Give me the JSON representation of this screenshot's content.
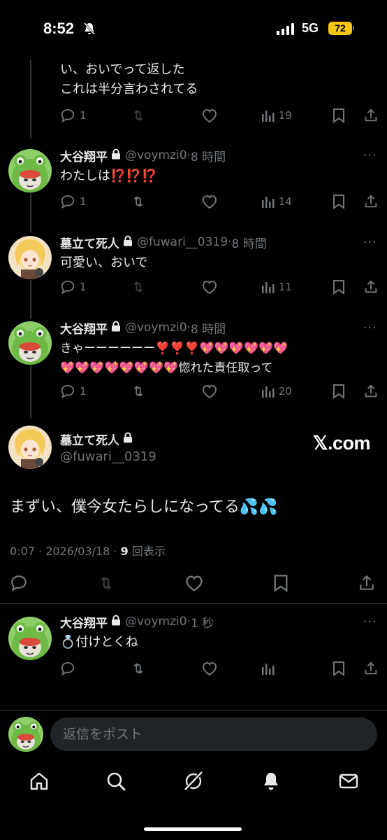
{
  "status": {
    "time": "8:52",
    "network": "5G",
    "battery": "72"
  },
  "tweets": [
    {
      "text": "い、おいでって返した\nこれは半分言わされてる",
      "replies": "1",
      "views": "19"
    },
    {
      "name": "大谷翔平",
      "handle": "@voymzi0",
      "time": "8 時間",
      "text": "わたしは⁉️⁉️⁉️",
      "replies": "1",
      "views": "14"
    },
    {
      "name": "墓立て死人",
      "handle": "@fuwari__0319",
      "time": "8 時間",
      "text": "可愛い、おいで",
      "replies": "1",
      "views": "11"
    },
    {
      "name": "大谷翔平",
      "handle": "@voymzi0",
      "time": "8 時間",
      "text": "きゃーーーーーー❣️❣️❣️💖💖💖💖💖💖\n💖💖💖💖💖💖💖💖惚れた責任取って",
      "replies": "1",
      "views": "20"
    }
  ],
  "main": {
    "name": "墓立て死人",
    "handle": "@fuwari__0319",
    "watermark": "𝕏.com",
    "text": "まずい、僕今女たらしになってる💦💦",
    "meta_time": "0:07 · 2026/03/18 · ",
    "views_count": "9",
    "views_label": " 回表示"
  },
  "reply": {
    "name": "大谷翔平",
    "handle": "@voymzi0",
    "time": "1 秒",
    "text": "💍付けとくね"
  },
  "composer": {
    "placeholder": "返信をポスト"
  },
  "colors": {
    "background": "#000000",
    "text": "#e7e9ea",
    "muted": "#71767b",
    "battery": "#f5c518",
    "input_bg": "#202327"
  }
}
